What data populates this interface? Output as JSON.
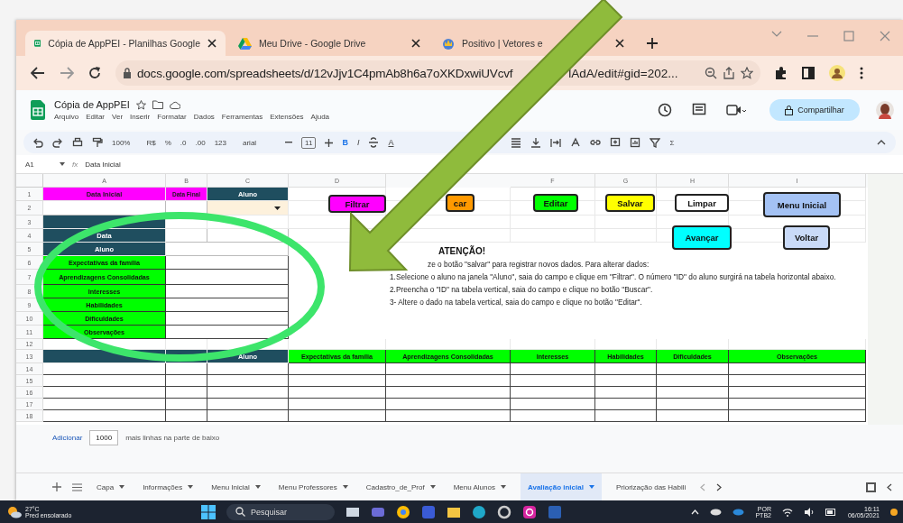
{
  "browser": {
    "tabs": [
      {
        "title": "Cópia de AppPEI - Planilhas Google",
        "selected": true
      },
      {
        "title": "Meu Drive - Google Drive",
        "selected": false
      },
      {
        "title": "Positivo | Vetores e",
        "selected": false
      }
    ],
    "url": [
      "docs.google.com/spreadsheets/d/12vJjv1C4pmAb8h6a7oXKDxwiUVcvf",
      "lAdA/edit#gid=202..."
    ]
  },
  "document": {
    "title": "Cópia de AppPEI",
    "menu": [
      "Arquivo",
      "Editar",
      "Ver",
      "Inserir",
      "Formatar",
      "Dados",
      "Ferramentas",
      "Extensões",
      "Ajuda"
    ],
    "share": "Compartilhar"
  },
  "toolbar": {
    "zoom": "100%",
    "currency": "R$",
    "percent": "%",
    "decimal_less": ".0",
    "decimal_more": ".00",
    "number_format": "123",
    "font": "arial",
    "font_size": "11",
    "bold": "B",
    "italic": "I",
    "text_color": "A",
    "sum": "Σ"
  },
  "formula_bar": {
    "cell": "A1",
    "fx": "fx",
    "value": "Data Inicial"
  },
  "columns": [
    "A",
    "B",
    "C",
    "D",
    "F",
    "G",
    "H",
    "I"
  ],
  "row_numbers": [
    "1",
    "2",
    "3",
    "4",
    "5",
    "6",
    "7",
    "8",
    "9",
    "10",
    "11",
    "12",
    "13",
    "14",
    "15",
    "16",
    "17",
    "18"
  ],
  "filter": {
    "start_label": "Data Inicial",
    "end_label": "Data Final",
    "student_label": "Aluno"
  },
  "record": {
    "labels": [
      "Data",
      "Aluno"
    ],
    "fields": [
      "Expectativas da família",
      "Aprendizagens Consolidadas",
      "Interesses",
      "Habilidades",
      "Dificuldades",
      "Observações"
    ]
  },
  "buttons": [
    {
      "label": "Filtrar",
      "color": "#ff00ff"
    },
    {
      "label": "car",
      "color": "#ff9900"
    },
    {
      "label": "Editar",
      "color": "#00ff00"
    },
    {
      "label": "Salvar",
      "color": "#ffff00"
    },
    {
      "label": "Limpar",
      "color": "#ffffff"
    },
    {
      "label": "Menu Inicial",
      "color": "#a4c2f4"
    },
    {
      "label": "Avançar",
      "color": "#00ffff"
    },
    {
      "label": "Voltar",
      "color": "#c9daf8"
    }
  ],
  "notice": {
    "title": "ATENÇÃO!",
    "lines": [
      "ze o botão \"salvar\" para registrar novos dados. Para alterar dados:",
      "1.Selecione o aluno na janela \"Aluno\", saia do campo e clique em \"Filtrar\". O número \"ID\" do aluno surgirá na tabela horizontal abaixo.",
      "2.Preencha o \"ID\" na tabela vertical, saia do campo e clique no botão \"Buscar\".",
      "3- Altere o dado na tabela vertical, saia do campo e clique no botão \"Editar\"."
    ]
  },
  "table": {
    "columns": [
      "Aluno",
      "Expectativas da família",
      "Aprendizagens Consolidadas",
      "Interesses",
      "Habilidades",
      "Dificuldades",
      "Observações"
    ]
  },
  "add_rows": {
    "link": "Adicionar",
    "count": "1000",
    "suffix": "mais linhas na parte de baixo"
  },
  "sheets": [
    {
      "name": "Capa",
      "selected": false
    },
    {
      "name": "Informações",
      "selected": false
    },
    {
      "name": "Menu Inicial",
      "selected": false
    },
    {
      "name": "Menu Professores",
      "selected": false
    },
    {
      "name": "Cadastro_de_Prof",
      "selected": false
    },
    {
      "name": "Menu Alunos",
      "selected": false
    },
    {
      "name": "Avaliação inicial",
      "selected": true
    },
    {
      "name": "Priorização das Habili",
      "selected": false
    }
  ],
  "taskbar": {
    "temperature": "27°C",
    "weather": "Pred ensolarado",
    "search": "Pesquisar",
    "language": "POR",
    "layout": "PTB2",
    "time": "16:11",
    "date": "06/05/2021"
  }
}
